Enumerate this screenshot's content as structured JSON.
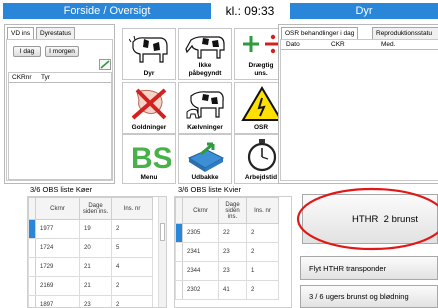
{
  "header": {
    "left_title": "Forside / Oversigt",
    "clock": "kl.: 09:33",
    "right_title": "Dyr"
  },
  "left_panel": {
    "tabs": [
      "VD ins",
      "Dyrestatus"
    ],
    "buttons": {
      "today": "I dag",
      "tomorrow": "I morgen"
    },
    "list_headers": {
      "ckr": "CKRnr",
      "type": "Tyr"
    }
  },
  "tiles": [
    {
      "id": "dyr",
      "label": "Dyr",
      "icon": "cow-icon"
    },
    {
      "id": "ikke",
      "label": "Ikke\npåbegyndt",
      "icon": "cow-grazing-icon"
    },
    {
      "id": "draegtig",
      "label": "Drægtig\nuns.",
      "icon": "plus-divide-icon"
    },
    {
      "id": "goldninger",
      "label": "Goldninger",
      "icon": "no-milk-icon"
    },
    {
      "id": "kaelvninger",
      "label": "Kælvninger",
      "icon": "calving-icon"
    },
    {
      "id": "osr",
      "label": "OSR",
      "icon": "warning-icon"
    },
    {
      "id": "menu",
      "label": "Menu",
      "icon": "bs-logo-icon"
    },
    {
      "id": "udbakke",
      "label": "Udbakke",
      "icon": "outbox-icon"
    },
    {
      "id": "arbejdstid",
      "label": "Arbejdstid",
      "icon": "stopwatch-icon"
    }
  ],
  "right_panel": {
    "tabs": [
      "OSR behandlinger i dag",
      "Reproduktionsstatu"
    ],
    "columns": [
      "Dato",
      "CKR",
      "Med."
    ]
  },
  "obs_cows": {
    "title": "3/6 OBS liste Køer",
    "columns": [
      "Ckrnr",
      "Dage siden ins.",
      "Ins. nr"
    ],
    "rows": [
      [
        "1977",
        "19",
        "2"
      ],
      [
        "1724",
        "20",
        "5"
      ],
      [
        "1729",
        "21",
        "4"
      ],
      [
        "2169",
        "21",
        "2"
      ],
      [
        "1897",
        "23",
        "2"
      ]
    ]
  },
  "obs_heifers": {
    "title": "3/6 OBS liste Kvier",
    "columns": [
      "Ckrnr",
      "Dage siden ins.",
      "Ins. nr"
    ],
    "rows": [
      [
        "2305",
        "22",
        "2"
      ],
      [
        "2341",
        "23",
        "2"
      ],
      [
        "2344",
        "23",
        "1"
      ],
      [
        "2302",
        "41",
        "2"
      ]
    ]
  },
  "actions": {
    "hthr_label": "HTHR",
    "hthr_count": "2 brunst",
    "transponder": "Flyt HTHR transponder",
    "bleeding": "3 / 6 ugers brunst og blødning"
  },
  "colors": {
    "accent": "#2a86d8",
    "highlight": "#e01818"
  }
}
